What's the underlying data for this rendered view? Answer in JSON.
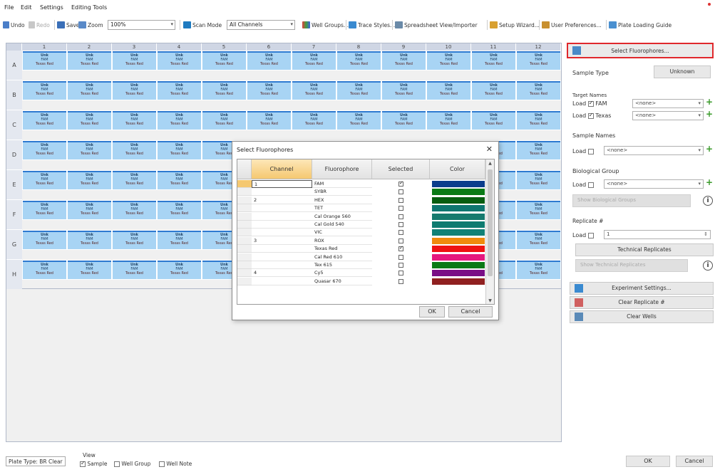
{
  "menu": {
    "items": [
      "File",
      "Edit",
      "Settings",
      "Editing Tools"
    ]
  },
  "toolbar": {
    "undo": "Undo",
    "redo": "Redo",
    "save": "Save",
    "zoom_label": "Zoom",
    "zoom_value": "100%",
    "scan_mode_label": "Scan Mode",
    "scan_mode_value": "All Channels",
    "well_groups": "Well Groups...",
    "trace_styles": "Trace Styles...",
    "spreadsheet": "Spreadsheet View/Importer",
    "setup_wizard": "Setup Wizard...",
    "user_prefs": "User Preferences...",
    "plate_guide": "Plate Loading Guide"
  },
  "plate": {
    "columns": [
      "1",
      "2",
      "3",
      "4",
      "5",
      "6",
      "7",
      "8",
      "9",
      "10",
      "11",
      "12"
    ],
    "rows": [
      "A",
      "B",
      "C",
      "D",
      "E",
      "F",
      "G",
      "H"
    ],
    "well": {
      "type": "Unk",
      "target1": "FAM",
      "target2": "Texas Red"
    }
  },
  "right_panel": {
    "select_fluorophores": "Select Fluorophores...",
    "sample_type_label": "Sample Type",
    "sample_type_value": "Unknown",
    "target_names_label": "Target Names",
    "load": "Load",
    "target1_name": "FAM",
    "target2_name": "Texas",
    "none": "<none>",
    "sample_names_label": "Sample Names",
    "bio_group_label": "Biological Group",
    "show_bio_groups": "Show Biological Groups",
    "replicate_label": "Replicate #",
    "replicate_value": "1",
    "technical_replicates": "Technical Replicates",
    "show_tech_replicates": "Show Technical Replicates",
    "experiment_settings": "Experiment Settings...",
    "clear_replicates": "Clear Replicate #",
    "clear_wells": "Clear Wells"
  },
  "status": {
    "plate_type": "Plate Type: BR Clear",
    "view_label": "View",
    "view_sample": "Sample",
    "view_well_group": "Well Group",
    "view_well_note": "Well Note",
    "ok": "OK",
    "cancel": "Cancel"
  },
  "dialog": {
    "title": "Select Fluorophores",
    "close": "✕",
    "headers": {
      "channel": "Channel",
      "fluorophore": "Fluorophore",
      "selected": "Selected",
      "color": "Color"
    },
    "rows": [
      {
        "channel": "1",
        "fluor": "FAM",
        "selected": true,
        "color": "#0b3d8c"
      },
      {
        "channel": "",
        "fluor": "SYBR",
        "selected": false,
        "color": "#0a7a16"
      },
      {
        "channel": "2",
        "fluor": "HEX",
        "selected": false,
        "color": "#075d10"
      },
      {
        "channel": "",
        "fluor": "TET",
        "selected": false,
        "color": "#0e7670"
      },
      {
        "channel": "",
        "fluor": "Cal Orange 560",
        "selected": false,
        "color": "#167a6e"
      },
      {
        "channel": "",
        "fluor": "Cal Gold 540",
        "selected": false,
        "color": "#0e7b70"
      },
      {
        "channel": "",
        "fluor": "VIC",
        "selected": false,
        "color": "#118176"
      },
      {
        "channel": "3",
        "fluor": "ROX",
        "selected": false,
        "color": "#f08a0c"
      },
      {
        "channel": "",
        "fluor": "Texas Red",
        "selected": true,
        "color": "#ee1212"
      },
      {
        "channel": "",
        "fluor": "Cal Red 610",
        "selected": false,
        "color": "#e5187e"
      },
      {
        "channel": "",
        "fluor": "Tex 615",
        "selected": false,
        "color": "#0a7a16"
      },
      {
        "channel": "4",
        "fluor": "Cy5",
        "selected": false,
        "color": "#7a0e86"
      },
      {
        "channel": "",
        "fluor": "Quasar 670",
        "selected": false,
        "color": "#902020"
      }
    ],
    "ok": "OK",
    "cancel": "Cancel"
  },
  "colors": {
    "well_fill": "#a8d4f4",
    "well_stripe": "#2e7ad0",
    "highlight": "#e0282c",
    "header_selected": "#f5c870"
  }
}
